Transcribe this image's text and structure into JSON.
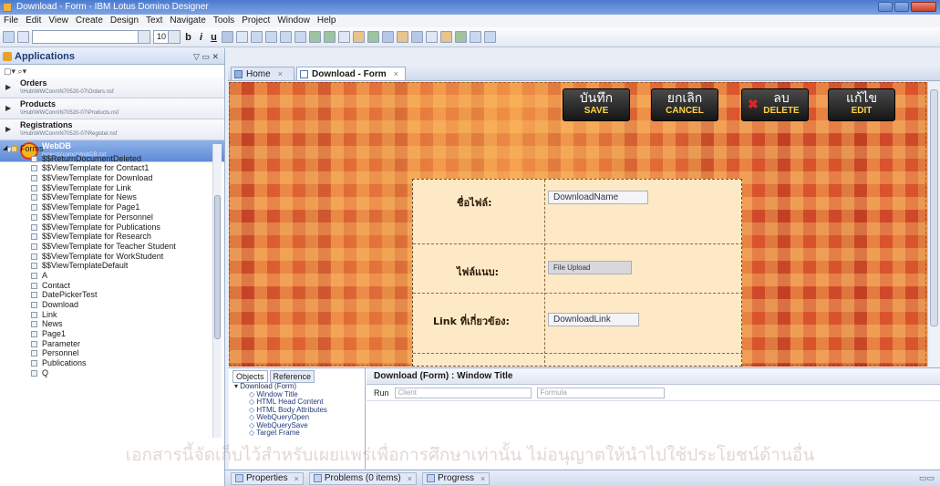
{
  "window": {
    "title": "Download - Form - IBM Lotus Domino Designer"
  },
  "menu": [
    "File",
    "Edit",
    "View",
    "Create",
    "Design",
    "Text",
    "Navigate",
    "Tools",
    "Project",
    "Window",
    "Help"
  ],
  "toolbar": {
    "font_size": "10"
  },
  "applications": {
    "title": "Applications",
    "databases": [
      {
        "name": "Orders",
        "path": "\\\\Hub\\WWConn\\N70520-07\\Orders.nsf"
      },
      {
        "name": "Products",
        "path": "\\\\Hub\\WWConn\\N70520-07\\Products.nsf"
      },
      {
        "name": "Registrations",
        "path": "\\\\Hub\\WWConn\\N70520-07\\Register.nsf"
      },
      {
        "name": "WebDB",
        "path": "projects\\comci\\WebDB.nsf"
      }
    ],
    "tree": [
      {
        "label": "Forms",
        "kind": "folder"
      },
      {
        "label": "$$ReturnDocumentDeleted",
        "kind": "item"
      },
      {
        "label": "$$ViewTemplate for Contact1",
        "kind": "item"
      },
      {
        "label": "$$ViewTemplate for Download",
        "kind": "item"
      },
      {
        "label": "$$ViewTemplate for Link",
        "kind": "item"
      },
      {
        "label": "$$ViewTemplate for News",
        "kind": "item"
      },
      {
        "label": "$$ViewTemplate for Page1",
        "kind": "item"
      },
      {
        "label": "$$ViewTemplate for Personnel",
        "kind": "item"
      },
      {
        "label": "$$ViewTemplate for Publications",
        "kind": "item"
      },
      {
        "label": "$$ViewTemplate for Research",
        "kind": "item"
      },
      {
        "label": "$$ViewTemplate for Teacher Student",
        "kind": "item"
      },
      {
        "label": "$$ViewTemplate for WorkStudent",
        "kind": "item"
      },
      {
        "label": "$$ViewTemplateDefault",
        "kind": "item"
      },
      {
        "label": "A",
        "kind": "item"
      },
      {
        "label": "Contact",
        "kind": "item"
      },
      {
        "label": "DatePickerTest",
        "kind": "item"
      },
      {
        "label": "Download",
        "kind": "item"
      },
      {
        "label": "Link",
        "kind": "item"
      },
      {
        "label": "News",
        "kind": "item"
      },
      {
        "label": "Page1",
        "kind": "item"
      },
      {
        "label": "Parameter",
        "kind": "item"
      },
      {
        "label": "Personnel",
        "kind": "item"
      },
      {
        "label": "Publications",
        "kind": "item"
      },
      {
        "label": "Q",
        "kind": "item"
      }
    ]
  },
  "editor": {
    "tabs": [
      {
        "label": "Home",
        "active": false
      },
      {
        "label": "Download - Form",
        "active": true
      }
    ],
    "actions": [
      {
        "th": "บันทึก",
        "en": "SAVE"
      },
      {
        "th": "ยกเลิก",
        "en": "CANCEL"
      },
      {
        "th": "ลบ",
        "en": "DELETE"
      },
      {
        "th": "แก้ไข",
        "en": "EDIT"
      }
    ],
    "form": {
      "rows": [
        {
          "label": "ชื่อไฟล์:",
          "field": "DownloadName"
        },
        {
          "label": "ไฟล์แนบ:",
          "field": "File Upload"
        },
        {
          "label": "Link ที่เกี่ยวข้อง:",
          "field": "DownloadLink"
        }
      ]
    }
  },
  "objects": {
    "tabs": [
      "Objects",
      "Reference"
    ],
    "root": "Download (Form)",
    "items": [
      "Window Title",
      "HTML Head Content",
      "HTML Body Attributes",
      "WebQueryOpen",
      "WebQuerySave",
      "Target Frame"
    ]
  },
  "script": {
    "title": "Download (Form) : Window Title",
    "run_label": "Run",
    "run_value": "Client",
    "type_value": "Formula"
  },
  "statusbar": [
    {
      "label": "Properties"
    },
    {
      "label": "Problems (0 items)"
    },
    {
      "label": "Progress"
    }
  ],
  "watermark": {
    "line": "เอกสารนี้จัดเก็บไว้สำหรับเผยแพร่เพื่อการศึกษาเท่านั้น ไม่อนุญาตให้นำไปใช้ประโยชน์ด้านอื่น",
    "big": "จอมเกล้า"
  }
}
